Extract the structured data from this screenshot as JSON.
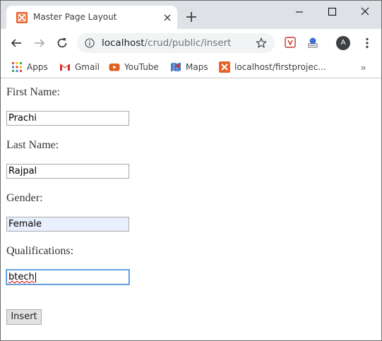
{
  "browser": {
    "tab_title": "Master Page Layout",
    "url_host": "localhost",
    "url_path": "/crud/public/insert",
    "avatar_initial": "A"
  },
  "bookmarks": [
    {
      "label": "Apps",
      "icon": "apps-grid-icon"
    },
    {
      "label": "Gmail",
      "icon": "gmail-icon"
    },
    {
      "label": "YouTube",
      "icon": "youtube-icon"
    },
    {
      "label": "Maps",
      "icon": "maps-icon"
    },
    {
      "label": "localhost/firstprojec...",
      "icon": "xampp-icon"
    }
  ],
  "bookmarks_more": "»",
  "form": {
    "first_name_label": "First Name:",
    "first_name_value": "Prachi",
    "last_name_label": "Last Name:",
    "last_name_value": "Rajpal",
    "gender_label": "Gender:",
    "gender_value": "Female",
    "qualifications_label": "Qualifications:",
    "qualifications_value": "btech",
    "submit_label": "Insert"
  },
  "colors": {
    "xampp_orange": "#e8622b",
    "autofill_bg": "#e8f0fe",
    "focus_border": "#4a90d9"
  }
}
